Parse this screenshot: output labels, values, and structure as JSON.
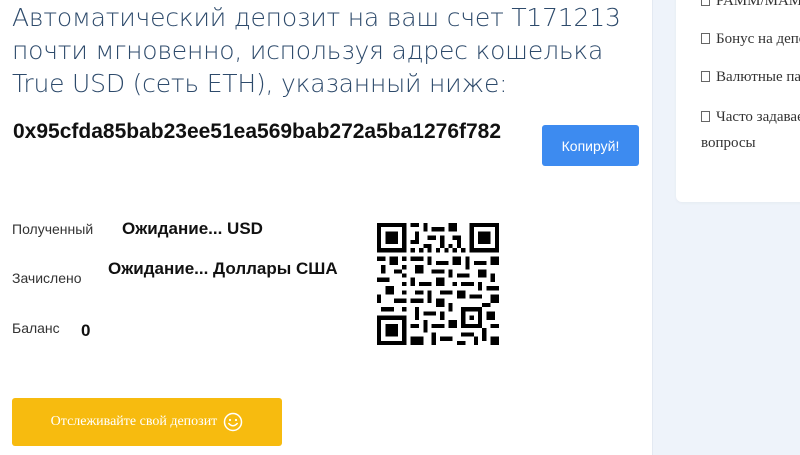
{
  "deposit": {
    "intro": "Автоматический депозит на ваш счет T171213 почти мгновенно, используя адрес кошелька True USD (сеть ETH), указанный ниже:",
    "address": "0x95cfda85bab23ee51ea569bab272a5ba1276f782",
    "copy_label": "Копируй!"
  },
  "status": {
    "received_label": "Полученный",
    "received_value": "Ожидание... USD",
    "credited_label": "Зачислено",
    "credited_value": "Ожидание... Доллары США",
    "balance_label": "Баланс",
    "balance_value": "0"
  },
  "track_button": {
    "label": "Отслеживайте свой депозит",
    "icon": "smile-icon"
  },
  "qr": {
    "icon": "qr-code"
  },
  "sidebar": {
    "items": [
      {
        "label": "PAMM/МАМ",
        "icon": "document-icon"
      },
      {
        "label": "Бонус на депозит",
        "icon": "document-icon"
      },
      {
        "label": "Валютные пары",
        "icon": "document-icon"
      },
      {
        "label": "Часто задаваемые",
        "label2": "вопросы",
        "icon": "document-icon"
      }
    ]
  },
  "colors": {
    "heading": "#2d4a6b",
    "copy_button": "#3d8bf0",
    "track_button": "#f7bb0f",
    "side_bg": "#eef3fa"
  }
}
